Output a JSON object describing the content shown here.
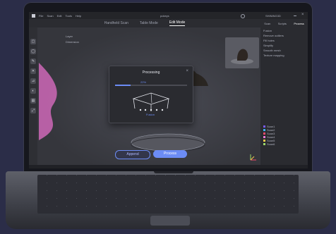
{
  "window": {
    "menu": [
      "File",
      "Scan",
      "Edit",
      "Tools",
      "Help"
    ],
    "title": "pokeys",
    "user": "SHINING3D"
  },
  "mode_tabs": [
    {
      "label": "Handheld Scan",
      "active": false
    },
    {
      "label": "Table Mode",
      "active": false
    },
    {
      "label": "Edit Mode",
      "active": true
    }
  ],
  "viewport": {
    "layer_label": "Layer",
    "dimension_label": "Dimension"
  },
  "dialog": {
    "title": "Processing",
    "close": "×",
    "progress": 0.22,
    "progress_label": "22%",
    "caption": "Fusion"
  },
  "right_panel": {
    "tabs": [
      "Scan",
      "Scripts",
      "Process"
    ],
    "active_tab": "Process",
    "options": [
      "Fusion",
      "Remove outliers",
      "Fill holes",
      "Simplify",
      "Smooth mesh",
      "Texture mapping"
    ],
    "frames": [
      {
        "name": "Scan1",
        "color": "#7b5cf0"
      },
      {
        "name": "Scan2",
        "color": "#3fb1f2"
      },
      {
        "name": "Scan3",
        "color": "#ef4a6b"
      },
      {
        "name": "Scan4",
        "color": "#f07ad4"
      },
      {
        "name": "Scan5",
        "color": "#f2c94c"
      },
      {
        "name": "Scan6",
        "color": "#9cd86a"
      }
    ]
  },
  "actions": {
    "append": "Append",
    "process": "Process"
  },
  "colors": {
    "accent": "#6c8cf5",
    "histogram": "#e36fc8"
  }
}
